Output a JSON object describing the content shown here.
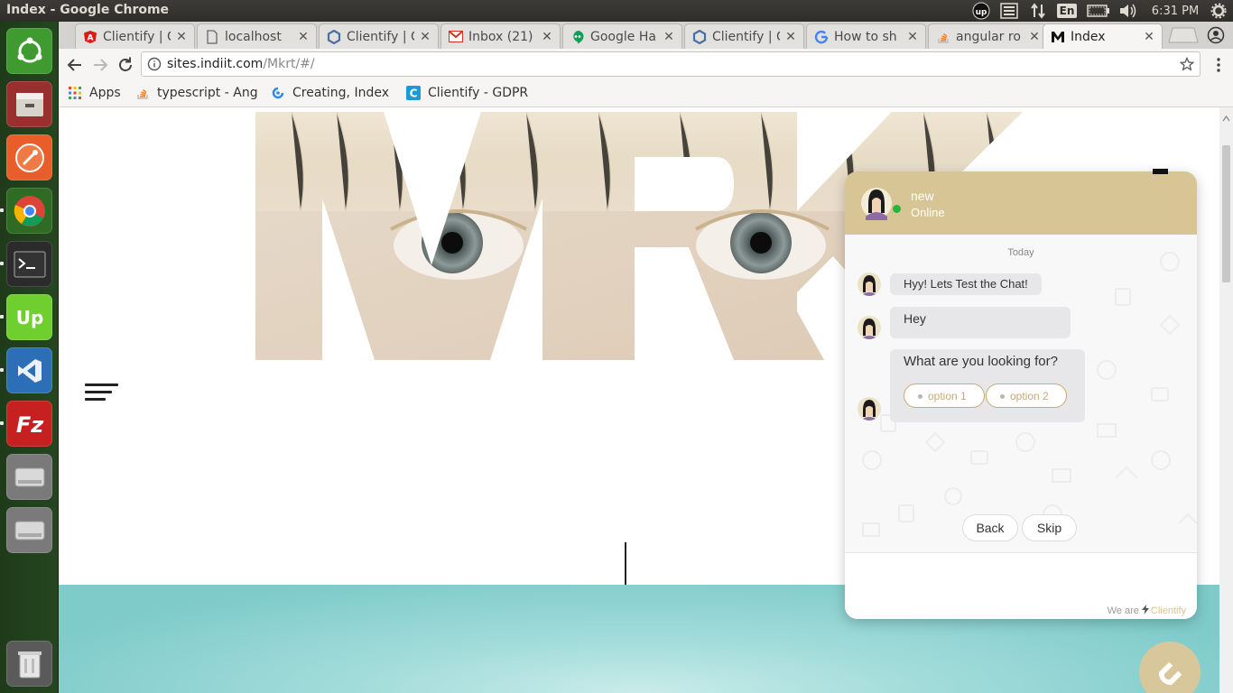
{
  "window": {
    "title": "Index - Google Chrome"
  },
  "top_panel": {
    "keyboard_layout": "En",
    "clock": "6:31 PM",
    "tray_icons": [
      "upwork-icon",
      "menu-list-icon",
      "network-transfer-icon",
      "keyboard-icon",
      "battery-icon",
      "volume-icon",
      "gear-icon"
    ]
  },
  "launcher": {
    "items": [
      {
        "name": "ubuntu-dash-icon",
        "color": "#3a8f2c"
      },
      {
        "name": "files-icon",
        "color": "#b73a3a"
      },
      {
        "name": "postman-icon",
        "color": "#e85d2a"
      },
      {
        "name": "chrome-icon",
        "color": "#3a7d2f"
      },
      {
        "name": "terminal-icon",
        "color": "#2b2b2b"
      },
      {
        "name": "upwork-icon",
        "color": "#6fcf2f"
      },
      {
        "name": "vscode-icon",
        "color": "#2d6fb6"
      },
      {
        "name": "filezilla-icon",
        "color": "#c62020"
      },
      {
        "name": "drive-icon",
        "color": "#8f8f8f"
      },
      {
        "name": "drive-icon",
        "color": "#8f8f8f"
      },
      {
        "name": "trash-icon",
        "color": "#6a6a6a"
      }
    ]
  },
  "browser": {
    "tabs": [
      {
        "title": "Clientify | C",
        "icon": "angular-icon",
        "icon_color": "#dd1b16"
      },
      {
        "title": "localhost",
        "icon": "page-icon",
        "icon_color": "#666666"
      },
      {
        "title": "Clientify | C",
        "icon": "hexagon-icon",
        "icon_color": "#4a6fa5"
      },
      {
        "title": "Inbox (21)",
        "icon": "gmail-icon",
        "icon_color": "#d93025"
      },
      {
        "title": "Google Ha",
        "icon": "hangouts-icon",
        "icon_color": "#0f9d58"
      },
      {
        "title": "Clientify | C",
        "icon": "hexagon-icon",
        "icon_color": "#4a6fa5"
      },
      {
        "title": "How to sh",
        "icon": "google-icon",
        "icon_color": "#4285f4"
      },
      {
        "title": "angular ro",
        "icon": "stackoverflow-icon",
        "icon_color": "#f48024"
      },
      {
        "title": "Index",
        "icon": "m-logo-icon",
        "icon_color": "#111111"
      }
    ],
    "close_glyph": "✕",
    "url": {
      "host": "sites.indiit.com",
      "path": "/Mkrt/#/"
    },
    "bookmarks": [
      {
        "label": "Apps",
        "icon": "apps-grid-icon"
      },
      {
        "label": "typescript - Ang",
        "icon": "stackoverflow-icon"
      },
      {
        "label": "Creating, Index",
        "icon": "blue-swirl-icon"
      },
      {
        "label": "Clientify - GDPR",
        "icon": "clientify-icon"
      }
    ]
  },
  "page": {
    "hero_text": "MRK",
    "band_color": "#9ad8d6"
  },
  "chat": {
    "header_color": "#d7c595",
    "agent_name": "new",
    "agent_status": "Online",
    "date_divider": "Today",
    "messages": [
      {
        "text": "Hyy! Lets Test the Chat!"
      },
      {
        "text": "Hey"
      },
      {
        "text": "What are you looking for?"
      }
    ],
    "options": [
      "option 1",
      "option 2"
    ],
    "back_label": "Back",
    "skip_label": "Skip",
    "footer_prefix": "We are",
    "footer_brand": "Clientify",
    "launcher_icon": "magnet-icon"
  }
}
